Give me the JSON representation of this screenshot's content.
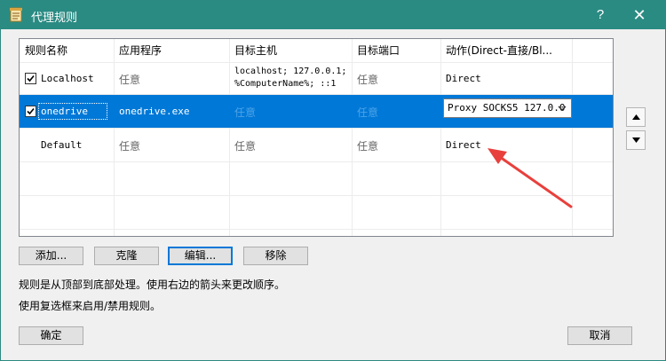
{
  "window": {
    "title": "代理规则",
    "help": "?",
    "close": "✕"
  },
  "columns": [
    "规则名称",
    "应用程序",
    "目标主机",
    "目标端口",
    "动作(Direct-直接/Bl..."
  ],
  "rows": [
    {
      "name": "Localhost",
      "checked": true,
      "app": "任意",
      "host_line1": "localhost; 127.0.0.1;",
      "host_line2": "%ComputerName%; ::1",
      "port": "任意",
      "action": "Direct"
    },
    {
      "name": "onedrive",
      "checked": true,
      "app": "onedrive.exe",
      "host": "任意",
      "port": "任意",
      "action": "Proxy SOCKS5 127.0.0"
    },
    {
      "name": "Default",
      "checked": false,
      "app": "任意",
      "host": "任意",
      "port": "任意",
      "action": "Direct"
    }
  ],
  "buttons": {
    "add": "添加...",
    "clone": "克隆",
    "edit": "编辑...",
    "remove": "移除",
    "ok": "确定",
    "cancel": "取消"
  },
  "info": {
    "line1": "规则是从顶部到底部处理。使用右边的箭头来更改顺序。",
    "line2": "使用复选框来启用/禁用规则。"
  },
  "icons": {
    "title": "rules-document-icon",
    "move_up": "triangle-up-icon",
    "move_down": "triangle-down-icon",
    "dropdown": "chevron-down-icon",
    "checkbox": "checkmark-icon"
  },
  "colors": {
    "titlebar": "#2a8b83",
    "selection": "#0078d7",
    "annotation_arrow": "#e8403c"
  }
}
